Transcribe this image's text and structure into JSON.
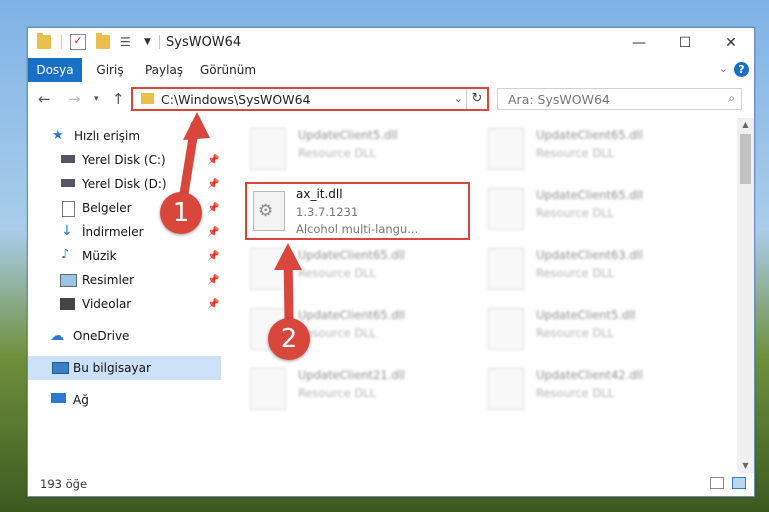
{
  "window": {
    "title": "SysWOW64"
  },
  "window_controls": {
    "minimize": "—",
    "maximize": "☐",
    "close": "✕"
  },
  "ribbon": {
    "tabs": [
      {
        "label": "Dosya",
        "active": true
      },
      {
        "label": "Giriş"
      },
      {
        "label": "Paylaş"
      },
      {
        "label": "Görünüm"
      }
    ],
    "help": "?"
  },
  "address": {
    "path": "C:\\Windows\\SysWOW64"
  },
  "search": {
    "placeholder": "Ara: SysWOW64"
  },
  "sidebar": {
    "items": [
      {
        "label": "Hızlı erişim",
        "icon": "star-icon"
      },
      {
        "label": "Yerel Disk (C:)",
        "icon": "drive-icon",
        "pinned": true
      },
      {
        "label": "Yerel Disk (D:)",
        "icon": "drive-icon",
        "pinned": true
      },
      {
        "label": "Belgeler",
        "icon": "document-icon",
        "pinned": true
      },
      {
        "label": "İndirmeler",
        "icon": "download-icon",
        "pinned": true
      },
      {
        "label": "Müzik",
        "icon": "music-icon",
        "pinned": true
      },
      {
        "label": "Resimler",
        "icon": "pictures-icon",
        "pinned": true
      },
      {
        "label": "Videolar",
        "icon": "video-icon",
        "pinned": true
      },
      {
        "label": "OneDrive",
        "icon": "cloud-icon"
      },
      {
        "label": "Bu bilgisayar",
        "icon": "computer-icon",
        "selected": true
      },
      {
        "label": "Ağ",
        "icon": "network-icon"
      }
    ]
  },
  "files": {
    "selected": {
      "name": "ax_it.dll",
      "version": "1.3.7.1231",
      "description": "Alcohol multi-langu..."
    },
    "blurred": [
      {
        "name": "UpdateClient5.dll",
        "desc": "Resource DLL"
      },
      {
        "name": "UpdateClient65.dll",
        "desc": "Resource DLL"
      },
      {
        "name": "UpdateClient65.dll",
        "desc": "Resource DLL"
      },
      {
        "name": "UpdateClient65.dll",
        "desc": "Resource DLL"
      },
      {
        "name": "UpdateClient63.dll",
        "desc": "Resource DLL"
      },
      {
        "name": "UpdateClient65.dll",
        "desc": "Resource DLL"
      },
      {
        "name": "UpdateClient5.dll",
        "desc": "Resource DLL"
      },
      {
        "name": "UpdateClient21.dll",
        "desc": "Resource DLL"
      },
      {
        "name": "UpdateClient42.dll",
        "desc": "Resource DLL"
      }
    ]
  },
  "status": {
    "item_count": "193 öğe"
  },
  "annotations": {
    "step1": "1",
    "step2": "2",
    "color": "#d9463c"
  }
}
